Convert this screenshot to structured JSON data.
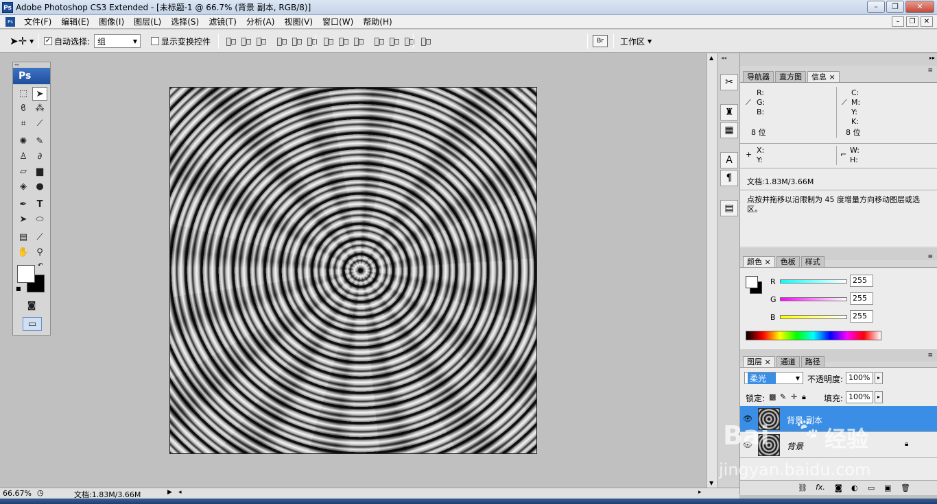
{
  "window": {
    "title": "Adobe Photoshop CS3 Extended - [未标题-1 @ 66.7% (背景 副本, RGB/8)]",
    "controls": [
      "–",
      "❐",
      "✕"
    ]
  },
  "menu": {
    "items": [
      "文件(F)",
      "编辑(E)",
      "图像(I)",
      "图层(L)",
      "选择(S)",
      "滤镜(T)",
      "分析(A)",
      "视图(V)",
      "窗口(W)",
      "帮助(H)"
    ]
  },
  "options": {
    "auto_select_label": "自动选择:",
    "auto_select_value": "组",
    "show_transform_label": "显示变换控件",
    "workspace_label": "工作区"
  },
  "tools_panel": {
    "header": "Ps"
  },
  "info_panel": {
    "tabs": [
      "导航器",
      "直方图",
      "信息"
    ],
    "rgb_labels": [
      "R:",
      "G:",
      "B:"
    ],
    "cmyk_labels": [
      "C:",
      "M:",
      "Y:",
      "K:"
    ],
    "bit_left": "8 位",
    "bit_right": "8 位",
    "x_label": "X:",
    "y_label": "Y:",
    "w_label": "W:",
    "h_label": "H:",
    "doc_size": "文档:1.83M/3.66M",
    "hint": "点按并拖移以沿限制为 45 度增量方向移动图层或选区。"
  },
  "color_panel": {
    "tabs": [
      "颜色",
      "色板",
      "样式"
    ],
    "channels": [
      {
        "label": "R",
        "value": "255"
      },
      {
        "label": "G",
        "value": "255"
      },
      {
        "label": "B",
        "value": "255"
      }
    ]
  },
  "layers_panel": {
    "tabs": [
      "图层",
      "通道",
      "路径"
    ],
    "blend_mode": "柔光",
    "opacity_label": "不透明度:",
    "opacity_value": "100%",
    "lock_label": "锁定:",
    "fill_label": "填充:",
    "fill_value": "100%",
    "layers": [
      {
        "name": "背景 副本",
        "selected": true
      },
      {
        "name": "背景",
        "selected": false
      }
    ]
  },
  "status": {
    "zoom": "66.67%",
    "doc_size": "文档:1.83M/3.66M"
  },
  "watermark": {
    "brand": "Bai",
    "brand_cn": "经验",
    "url": "jingyan.baidu.com"
  }
}
